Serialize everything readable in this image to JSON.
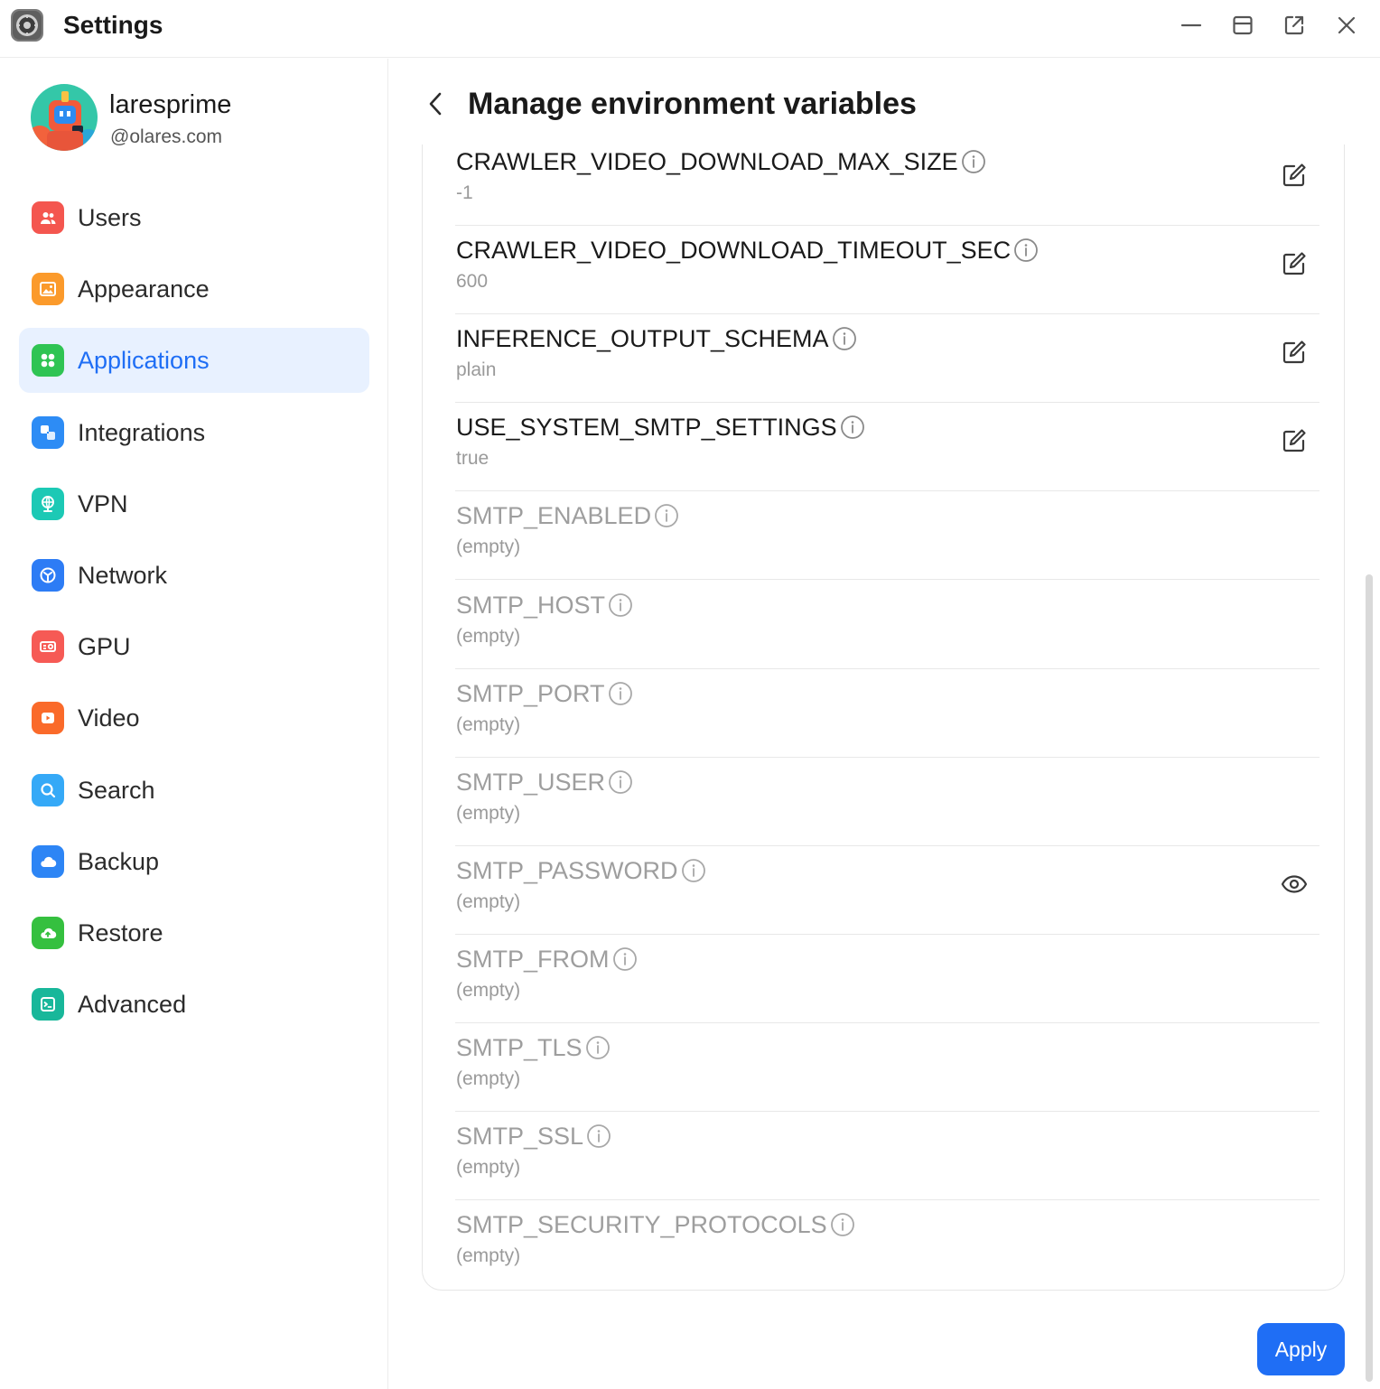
{
  "window": {
    "title": "Settings",
    "icon": "settings-gear-icon",
    "controls": [
      "minimize-icon",
      "maximize-icon",
      "open-external-icon",
      "close-icon"
    ]
  },
  "profile": {
    "name": "laresprime",
    "handle": "@olares.com"
  },
  "sidebar": {
    "items": [
      {
        "label": "Users",
        "icon": "users-icon",
        "color": "#f4564f",
        "active": false
      },
      {
        "label": "Appearance",
        "icon": "image-icon",
        "color": "#fb9a2b",
        "active": false
      },
      {
        "label": "Applications",
        "icon": "apps-icon",
        "color": "#2fc453",
        "active": true
      },
      {
        "label": "Integrations",
        "icon": "integrations-icon",
        "color": "#2d8cf5",
        "active": false
      },
      {
        "label": "VPN",
        "icon": "globe-icon",
        "color": "#1cc9b5",
        "active": false
      },
      {
        "label": "Network",
        "icon": "network-icon",
        "color": "#2d7cf5",
        "active": false
      },
      {
        "label": "GPU",
        "icon": "gpu-icon",
        "color": "#f65a55",
        "active": false
      },
      {
        "label": "Video",
        "icon": "video-icon",
        "color": "#fa6a2a",
        "active": false
      },
      {
        "label": "Search",
        "icon": "search-icon",
        "color": "#35a9f7",
        "active": false
      },
      {
        "label": "Backup",
        "icon": "cloud-icon",
        "color": "#2d85f5",
        "active": false
      },
      {
        "label": "Restore",
        "icon": "cloud-restore-icon",
        "color": "#35c03f",
        "active": false
      },
      {
        "label": "Advanced",
        "icon": "terminal-icon",
        "color": "#18b79a",
        "active": false
      }
    ]
  },
  "main": {
    "title": "Manage environment variables",
    "apply_label": "Apply",
    "accent": "#1f6ef5",
    "variables": [
      {
        "name": "CRAWLER_VIDEO_DOWNLOAD_MAX_SIZE",
        "value": "-1",
        "editable": true,
        "action": "edit-icon"
      },
      {
        "name": "CRAWLER_VIDEO_DOWNLOAD_TIMEOUT_SEC",
        "value": "600",
        "editable": true,
        "action": "edit-icon"
      },
      {
        "name": "INFERENCE_OUTPUT_SCHEMA",
        "value": "plain",
        "editable": true,
        "action": "edit-icon"
      },
      {
        "name": "USE_SYSTEM_SMTP_SETTINGS",
        "value": "true",
        "editable": true,
        "action": "edit-icon"
      },
      {
        "name": "SMTP_ENABLED",
        "value": "(empty)",
        "editable": false,
        "action": ""
      },
      {
        "name": "SMTP_HOST",
        "value": "(empty)",
        "editable": false,
        "action": ""
      },
      {
        "name": "SMTP_PORT",
        "value": "(empty)",
        "editable": false,
        "action": ""
      },
      {
        "name": "SMTP_USER",
        "value": "(empty)",
        "editable": false,
        "action": ""
      },
      {
        "name": "SMTP_PASSWORD",
        "value": "(empty)",
        "editable": false,
        "action": "eye-icon"
      },
      {
        "name": "SMTP_FROM",
        "value": "(empty)",
        "editable": false,
        "action": ""
      },
      {
        "name": "SMTP_TLS",
        "value": "(empty)",
        "editable": false,
        "action": ""
      },
      {
        "name": "SMTP_SSL",
        "value": "(empty)",
        "editable": false,
        "action": ""
      },
      {
        "name": "SMTP_SECURITY_PROTOCOLS",
        "value": "(empty)",
        "editable": false,
        "action": ""
      }
    ]
  }
}
